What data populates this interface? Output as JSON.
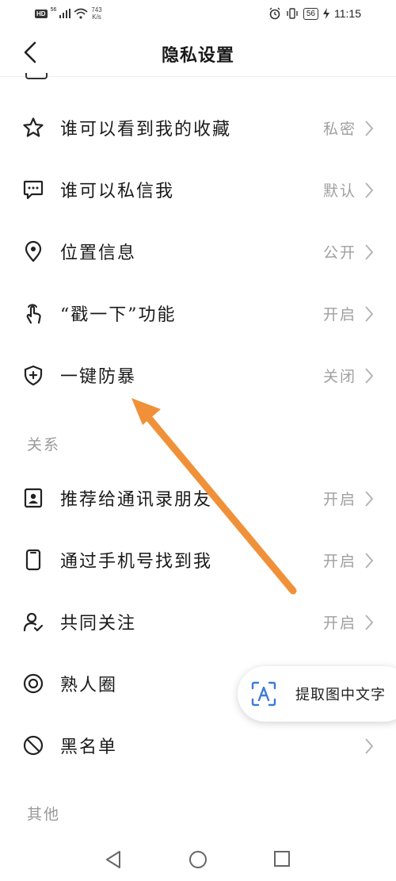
{
  "status_bar": {
    "hd": "HD",
    "signal_badge": "56",
    "net_speed_value": "743",
    "net_speed_unit": "K/s",
    "battery": "56",
    "time": "11:15"
  },
  "header": {
    "title": "隐私设置"
  },
  "privacy_items": [
    {
      "label": "谁可以看到我的收藏",
      "value": "私密",
      "icon": "star-icon"
    },
    {
      "label": "谁可以私信我",
      "value": "默认",
      "icon": "message-icon"
    },
    {
      "label": "位置信息",
      "value": "公开",
      "icon": "location-pin-icon"
    },
    {
      "label": "“戳一下”功能",
      "value": "开启",
      "icon": "tap-hand-icon"
    },
    {
      "label": "一键防暴",
      "value": "关闭",
      "icon": "shield-plus-icon"
    }
  ],
  "sections": {
    "relations": "关系",
    "others": "其他"
  },
  "relation_items": [
    {
      "label": "推荐给通讯录朋友",
      "value": "开启",
      "icon": "contact-card-icon"
    },
    {
      "label": "通过手机号找到我",
      "value": "开启",
      "icon": "phone-icon"
    },
    {
      "label": "共同关注",
      "value": "开启",
      "icon": "user-check-icon"
    },
    {
      "label": "熟人圈",
      "value": "",
      "icon": "circle-target-icon"
    },
    {
      "label": "黑名单",
      "value": "",
      "icon": "block-icon"
    }
  ],
  "ocr_button": {
    "label": "提取图中文字",
    "icon": "text-scan-icon"
  },
  "colors": {
    "annotation_arrow": "#f0913a",
    "muted_text": "#a0a0a0"
  }
}
